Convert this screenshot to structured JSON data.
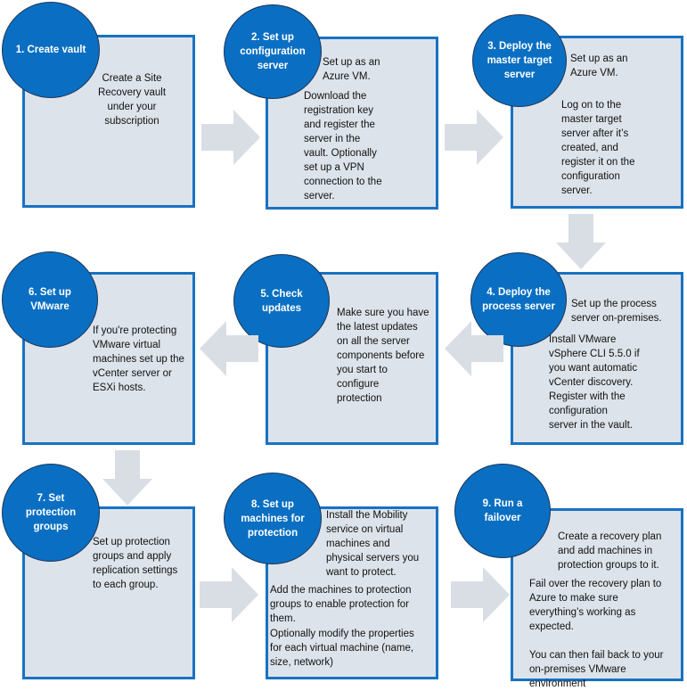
{
  "colors": {
    "box_fill": "#dde3ea",
    "box_border": "#1872c2",
    "circle_fill": "#0a6fc2",
    "arrow": "#d9dee5"
  },
  "steps": [
    {
      "id": "1",
      "title": "1. Create vault",
      "paragraphs": [
        "Create a Site\nRecovery vault\nunder your\nsubscription"
      ]
    },
    {
      "id": "2",
      "title": "2. Set up\nconfiguration\nserver",
      "paragraphs": [
        "Set up as an\nAzure VM.",
        "Download the\nregistration key\nand register the\nserver in the\nvault. Optionally\nset up a VPN\nconnection to the\nserver."
      ]
    },
    {
      "id": "3",
      "title": "3. Deploy the\nmaster target\nserver",
      "paragraphs": [
        "Set up as an\nAzure VM.",
        "Log on to the\nmaster target\nserver after it’s\ncreated, and\nregister it on the\nconfiguration\nserver."
      ]
    },
    {
      "id": "4",
      "title": "4. Deploy the\nprocess server",
      "paragraphs": [
        "Set up the process\nserver on-premises.",
        "Install VMware\nvSphere CLI 5.5.0 if\nyou want automatic\nvCenter discovery.\nRegister with the\nconfiguration\nserver in the vault."
      ]
    },
    {
      "id": "5",
      "title": "5. Check\nupdates",
      "paragraphs": [
        "Make sure you have\nthe latest updates\non all the server\ncomponents before\nyou start to\nconfigure\nprotection"
      ]
    },
    {
      "id": "6",
      "title": "6. Set up\nVMware",
      "paragraphs": [
        "If you're protecting\nVMware virtual\nmachines set up the\nvCenter server or\nESXi hosts."
      ]
    },
    {
      "id": "7",
      "title": "7. Set\nprotection\ngroups",
      "paragraphs": [
        "Set up protection\ngroups and apply\nreplication settings\nto each group."
      ]
    },
    {
      "id": "8",
      "title": "8. Set up\nmachines for\nprotection",
      "paragraphs": [
        "Install the Mobility\nservice on virtual\nmachines and\nphysical servers you\nwant to protect.",
        "Add the machines to protection\ngroups to enable protection for\nthem.",
        "Optionally modify the properties\nfor each virtual machine (name,\nsize, network)"
      ]
    },
    {
      "id": "9",
      "title": "9. Run a\nfailover",
      "paragraphs": [
        "Create a recovery plan\nand add machines in\nprotection groups to it.",
        "Fail over the recovery plan to\nAzure to make sure\neverything’s working as\nexpected.",
        "You can then fail back to your\non-premises VMware\nenvironment"
      ]
    }
  ],
  "arrows": [
    {
      "from": "1",
      "to": "2",
      "direction": "right"
    },
    {
      "from": "2",
      "to": "3",
      "direction": "right"
    },
    {
      "from": "3",
      "to": "4",
      "direction": "down"
    },
    {
      "from": "4",
      "to": "5",
      "direction": "left"
    },
    {
      "from": "5",
      "to": "6",
      "direction": "left"
    },
    {
      "from": "6",
      "to": "7",
      "direction": "down"
    },
    {
      "from": "7",
      "to": "8",
      "direction": "right"
    },
    {
      "from": "8",
      "to": "9",
      "direction": "right"
    }
  ]
}
